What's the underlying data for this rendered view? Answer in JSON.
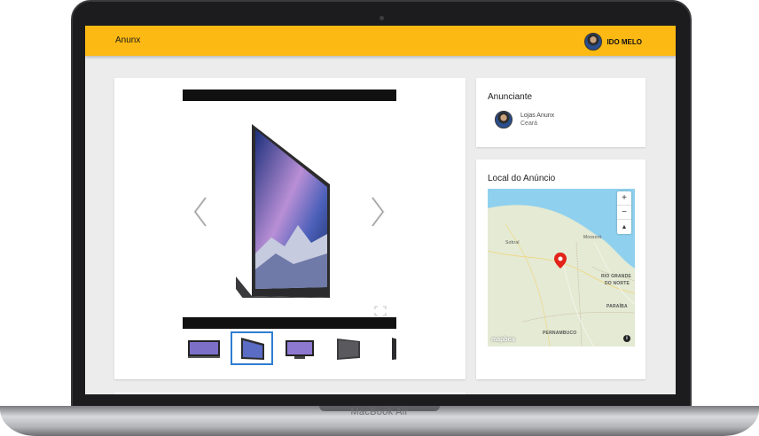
{
  "device": {
    "label": "MacBook Air"
  },
  "header": {
    "brand": "Anunx",
    "user_name": "IDO MELO"
  },
  "advertiser": {
    "title": "Anunciante",
    "name": "Lojas Anunx",
    "region": "Ceará"
  },
  "location": {
    "title": "Local do Anúncio",
    "map_labels": [
      "RIO GRANDE",
      "DO NORTE",
      "PARAÍBA",
      "PERNAMBUCO",
      "Mossoró",
      "Sobral"
    ],
    "attribution": "mapbox",
    "zoom_in": "+",
    "zoom_out": "−",
    "compass": "▲"
  },
  "gallery": {
    "thumbnail_count": 5,
    "active_thumbnail": 2
  },
  "colors": {
    "header": "#fdb913",
    "active_thumb": "#2f7dd3",
    "marker": "#e2231a",
    "sea": "#8fd0ee"
  }
}
